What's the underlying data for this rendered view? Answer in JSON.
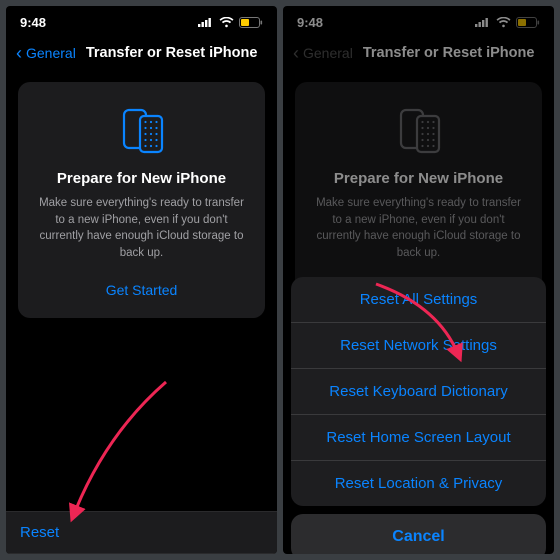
{
  "status": {
    "time": "9:48"
  },
  "nav": {
    "back": "General",
    "title": "Transfer or Reset iPhone"
  },
  "card": {
    "heading": "Prepare for New iPhone",
    "body": "Make sure everything's ready to transfer to a new iPhone, even if you don't currently have enough iCloud storage to back up.",
    "cta": "Get Started"
  },
  "reset_row": "Reset",
  "sheet": {
    "options": [
      "Reset All Settings",
      "Reset Network Settings",
      "Reset Keyboard Dictionary",
      "Reset Home Screen Layout",
      "Reset Location & Privacy"
    ],
    "cancel": "Cancel"
  },
  "colors": {
    "accent": "#0a84ff"
  }
}
